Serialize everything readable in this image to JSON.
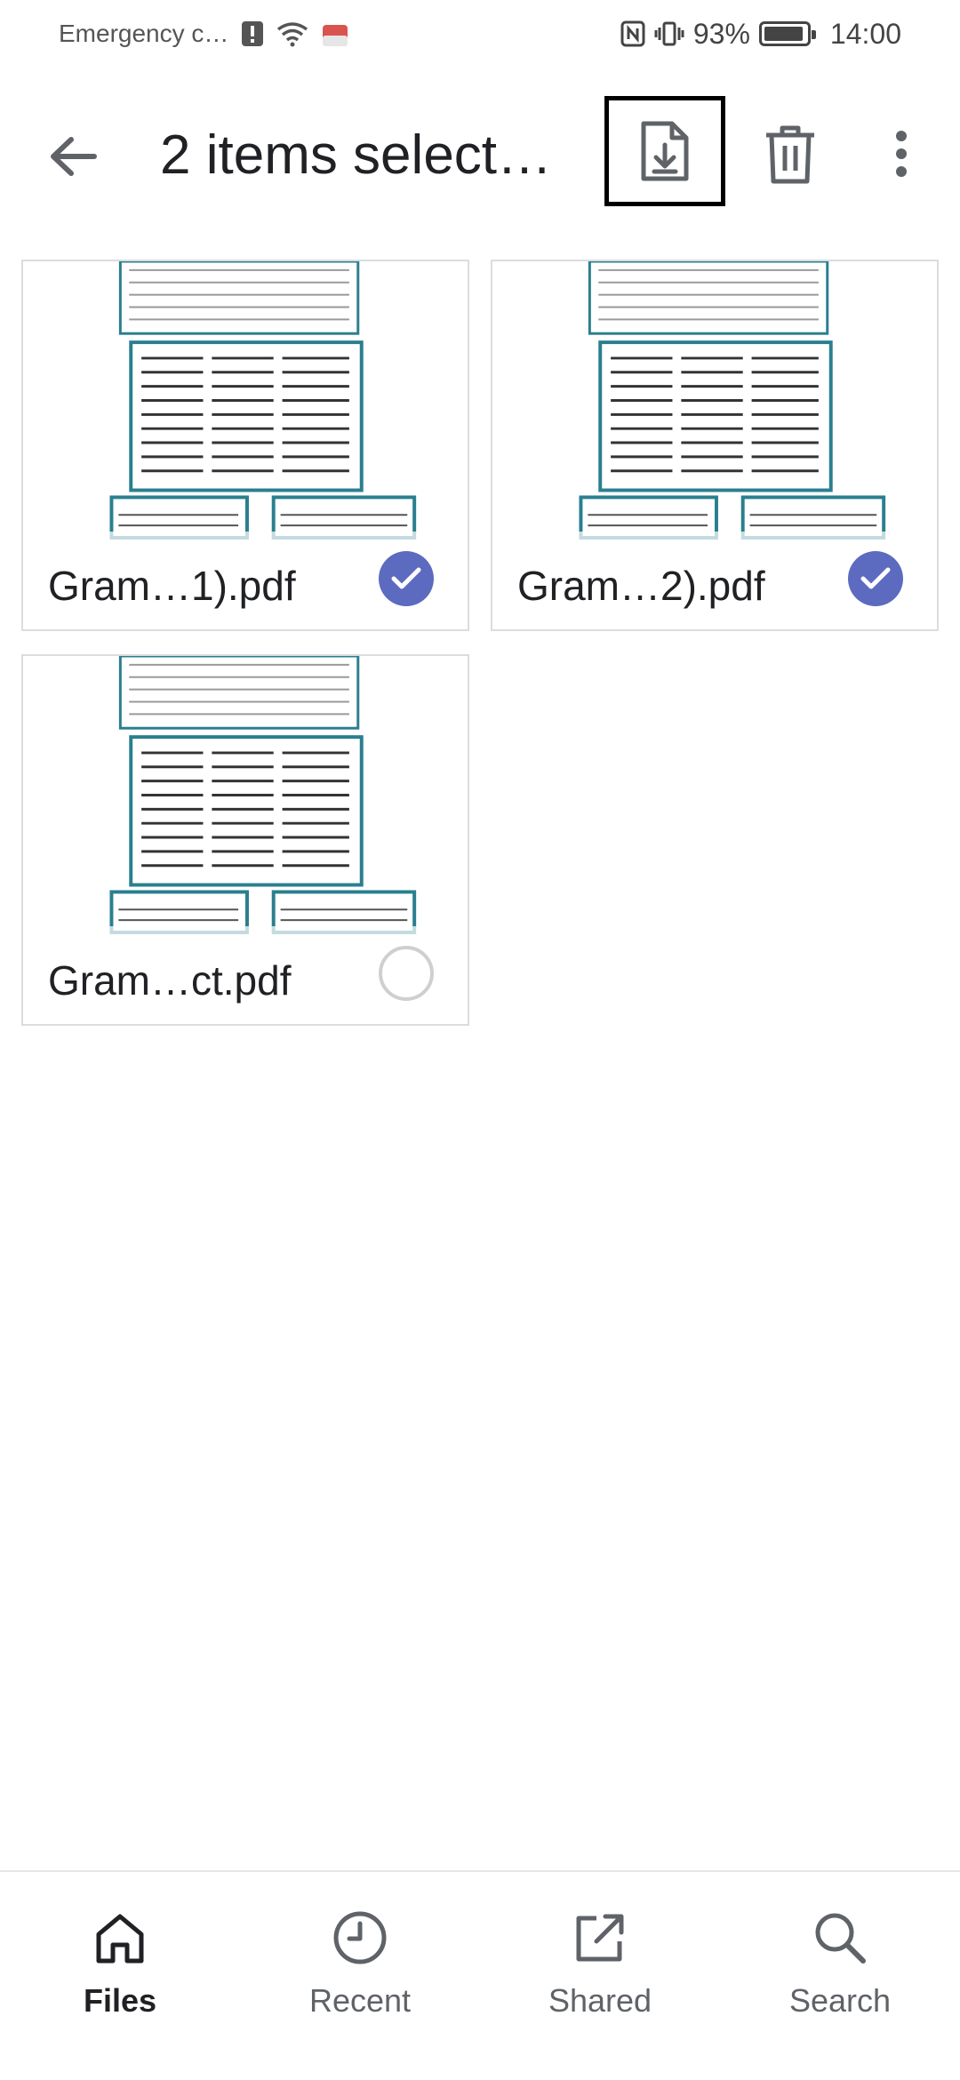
{
  "status_bar": {
    "left_text": "Emergency c…",
    "battery": "93%",
    "time": "14:00",
    "battery_level": 0.93
  },
  "toolbar": {
    "title": "2 items select…",
    "back_icon": "arrow-left-icon",
    "download_icon": "file-download-icon",
    "delete_icon": "trash-icon",
    "more_icon": "more-vert-icon"
  },
  "files": [
    {
      "name": "Gram…1).pdf",
      "selected": true
    },
    {
      "name": "Gram…2).pdf",
      "selected": true
    },
    {
      "name": "Gram…ct.pdf",
      "selected": false
    }
  ],
  "bottom_nav": {
    "items": [
      {
        "label": "Files",
        "icon": "home-icon",
        "active": true
      },
      {
        "label": "Recent",
        "icon": "clock-icon",
        "active": false
      },
      {
        "label": "Shared",
        "icon": "share-external-icon",
        "active": false
      },
      {
        "label": "Search",
        "icon": "search-icon",
        "active": false
      }
    ]
  },
  "colors": {
    "accent": "#5c6bc0",
    "text": "#202124",
    "muted": "#5f6368"
  }
}
